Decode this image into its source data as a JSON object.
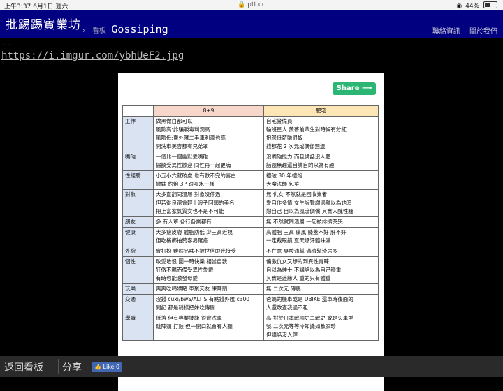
{
  "status": {
    "time": "上午3:37",
    "date": "6月1日 週六",
    "url": "ptt.cc",
    "battery": "44%",
    "battery_level": 0.44
  },
  "header": {
    "brand": "批踢踢實業坊",
    "crumb_sep": "›",
    "board_label": "看板",
    "board": "Gossiping",
    "nav": [
      "聯絡資訊",
      "關於我們"
    ]
  },
  "post": {
    "dashes": "--",
    "link": "https://i.imgur.com/ybhUeF2.jpg"
  },
  "card": {
    "share_label": "Share",
    "table": {
      "headers": [
        "",
        "8+9",
        "肥宅"
      ],
      "rows": [
        {
          "category": "工作",
          "a": [
            "做黑做白都可以",
            "風險高:詐騙販毒利潤高",
            "風險低:賣外匯二手車利潤也高",
            "開洗車美容都有兄弟罩"
          ],
          "b": [
            "自宅警備員",
            "輪班星人 羨慕前輩生對時候有分紅",
            "抱怨低薪賺很奴",
            "錢都花 2 次元或偶像週邊"
          ]
        },
        {
          "category": "嘴砲",
          "a": [
            "一個比一個幽默愛嘴砲",
            "儘談受異性歡迎 同性再一起更嗨"
          ],
          "b": [
            "沒嘴砲能力 而且講話沒人聽",
            "話題無趣還自講自的以為有趣"
          ]
        },
        {
          "category": "性經驗",
          "a": [
            "小五小六就破處 也有數不完的喜白",
            "撒妹 約炮 3P 跟喝水一樣"
          ],
          "b": [
            "禮破 30 年禮炮",
            "大魔法師 包莖"
          ]
        },
        {
          "category": "對象",
          "a": [
            "大多直翻同溫層 對象沒停過",
            "但若從良還會輕上浪子回頭的美名",
            "把上富家氣質女也不是不可能"
          ],
          "b": [
            "無 仇女 不然就是回收業者",
            "愛自作多情 女生說聲謝過就以為她暗",
            "戀自己 自以為風流倜儻 其實人醜性騷"
          ]
        },
        {
          "category": "朋友",
          "a": [
            "多 有人罩 各行各業都有"
          ],
          "b": [
            "無 不然就同溫層 一起被排擠哭哭"
          ]
        },
        {
          "category": "健康",
          "a": [
            "大多瘦皮膚 體脂肪低 少三高近視",
            "但吃檳榔抽菸容易罹癌"
          ],
          "b": [
            "高體脂 三高 痛風 膝蓋不好 肝不好",
            "一定戴眼鏡 夏天爆汗體味濃"
          ]
        },
        {
          "category": "外貌",
          "a": [
            "會打扮 雖然品味不被世俗眼光接受"
          ],
          "b": [
            "不在意 臭酸油膩 滿臉鬍渣居多"
          ]
        },
        {
          "category": "個性",
          "a": [
            "敢愛敢恨 圖一時快樂 相當自我",
            "狂傲不羈而備受異性愛戴",
            "有時也能激發母愛"
          ],
          "b": [
            "偏激仇女又想的到異性青睞",
            "自以為紳士 不講話以為自己穩重",
            "其實是邊緣人 重的只有體重"
          ]
        },
        {
          "category": "玩樂",
          "a": [
            "爽爽吃喝嫖賭 車聚交友 練陣頭"
          ],
          "b": [
            "無 二次元 磚農"
          ]
        },
        {
          "category": "交通",
          "a": [
            "沒錢 cuxi/bwS/ALTIS 有點錢外匯 c300",
            "閱記 都是稱樣把妹吃傳閱"
          ],
          "b": [
            "爸媽的機車或是 UBIKE 還車時後面的",
            "人還敢查我過不租"
          ]
        },
        {
          "category": "學識",
          "a": [
            "低落 但有專業技能 很會洗車",
            "跳陣頭 打鼓 但一開口就會有人聽"
          ],
          "b": [
            "高 對於日本戰國史二戰史 或是火車型",
            "號 二次元等等冷知識如數家珍",
            "但講話沒人理"
          ]
        }
      ]
    }
  },
  "footer": {
    "back": "返回看板",
    "share": "分享",
    "like_label": "Like 0"
  }
}
